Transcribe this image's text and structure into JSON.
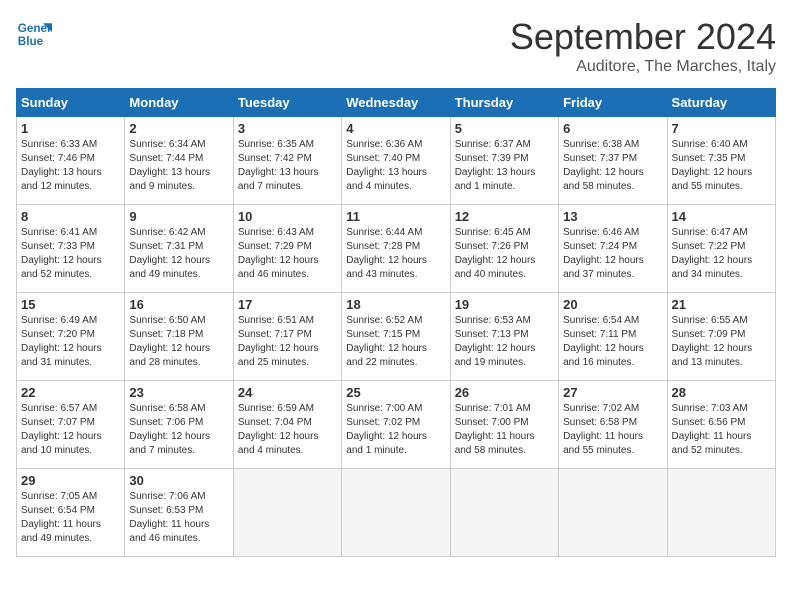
{
  "header": {
    "logo_line1": "General",
    "logo_line2": "Blue",
    "month": "September 2024",
    "location": "Auditore, The Marches, Italy"
  },
  "weekdays": [
    "Sunday",
    "Monday",
    "Tuesday",
    "Wednesday",
    "Thursday",
    "Friday",
    "Saturday"
  ],
  "weeks": [
    [
      {
        "day": "1",
        "lines": [
          "Sunrise: 6:33 AM",
          "Sunset: 7:46 PM",
          "Daylight: 13 hours",
          "and 12 minutes."
        ]
      },
      {
        "day": "2",
        "lines": [
          "Sunrise: 6:34 AM",
          "Sunset: 7:44 PM",
          "Daylight: 13 hours",
          "and 9 minutes."
        ]
      },
      {
        "day": "3",
        "lines": [
          "Sunrise: 6:35 AM",
          "Sunset: 7:42 PM",
          "Daylight: 13 hours",
          "and 7 minutes."
        ]
      },
      {
        "day": "4",
        "lines": [
          "Sunrise: 6:36 AM",
          "Sunset: 7:40 PM",
          "Daylight: 13 hours",
          "and 4 minutes."
        ]
      },
      {
        "day": "5",
        "lines": [
          "Sunrise: 6:37 AM",
          "Sunset: 7:39 PM",
          "Daylight: 13 hours",
          "and 1 minute."
        ]
      },
      {
        "day": "6",
        "lines": [
          "Sunrise: 6:38 AM",
          "Sunset: 7:37 PM",
          "Daylight: 12 hours",
          "and 58 minutes."
        ]
      },
      {
        "day": "7",
        "lines": [
          "Sunrise: 6:40 AM",
          "Sunset: 7:35 PM",
          "Daylight: 12 hours",
          "and 55 minutes."
        ]
      }
    ],
    [
      {
        "day": "8",
        "lines": [
          "Sunrise: 6:41 AM",
          "Sunset: 7:33 PM",
          "Daylight: 12 hours",
          "and 52 minutes."
        ]
      },
      {
        "day": "9",
        "lines": [
          "Sunrise: 6:42 AM",
          "Sunset: 7:31 PM",
          "Daylight: 12 hours",
          "and 49 minutes."
        ]
      },
      {
        "day": "10",
        "lines": [
          "Sunrise: 6:43 AM",
          "Sunset: 7:29 PM",
          "Daylight: 12 hours",
          "and 46 minutes."
        ]
      },
      {
        "day": "11",
        "lines": [
          "Sunrise: 6:44 AM",
          "Sunset: 7:28 PM",
          "Daylight: 12 hours",
          "and 43 minutes."
        ]
      },
      {
        "day": "12",
        "lines": [
          "Sunrise: 6:45 AM",
          "Sunset: 7:26 PM",
          "Daylight: 12 hours",
          "and 40 minutes."
        ]
      },
      {
        "day": "13",
        "lines": [
          "Sunrise: 6:46 AM",
          "Sunset: 7:24 PM",
          "Daylight: 12 hours",
          "and 37 minutes."
        ]
      },
      {
        "day": "14",
        "lines": [
          "Sunrise: 6:47 AM",
          "Sunset: 7:22 PM",
          "Daylight: 12 hours",
          "and 34 minutes."
        ]
      }
    ],
    [
      {
        "day": "15",
        "lines": [
          "Sunrise: 6:49 AM",
          "Sunset: 7:20 PM",
          "Daylight: 12 hours",
          "and 31 minutes."
        ]
      },
      {
        "day": "16",
        "lines": [
          "Sunrise: 6:50 AM",
          "Sunset: 7:18 PM",
          "Daylight: 12 hours",
          "and 28 minutes."
        ]
      },
      {
        "day": "17",
        "lines": [
          "Sunrise: 6:51 AM",
          "Sunset: 7:17 PM",
          "Daylight: 12 hours",
          "and 25 minutes."
        ]
      },
      {
        "day": "18",
        "lines": [
          "Sunrise: 6:52 AM",
          "Sunset: 7:15 PM",
          "Daylight: 12 hours",
          "and 22 minutes."
        ]
      },
      {
        "day": "19",
        "lines": [
          "Sunrise: 6:53 AM",
          "Sunset: 7:13 PM",
          "Daylight: 12 hours",
          "and 19 minutes."
        ]
      },
      {
        "day": "20",
        "lines": [
          "Sunrise: 6:54 AM",
          "Sunset: 7:11 PM",
          "Daylight: 12 hours",
          "and 16 minutes."
        ]
      },
      {
        "day": "21",
        "lines": [
          "Sunrise: 6:55 AM",
          "Sunset: 7:09 PM",
          "Daylight: 12 hours",
          "and 13 minutes."
        ]
      }
    ],
    [
      {
        "day": "22",
        "lines": [
          "Sunrise: 6:57 AM",
          "Sunset: 7:07 PM",
          "Daylight: 12 hours",
          "and 10 minutes."
        ]
      },
      {
        "day": "23",
        "lines": [
          "Sunrise: 6:58 AM",
          "Sunset: 7:06 PM",
          "Daylight: 12 hours",
          "and 7 minutes."
        ]
      },
      {
        "day": "24",
        "lines": [
          "Sunrise: 6:59 AM",
          "Sunset: 7:04 PM",
          "Daylight: 12 hours",
          "and 4 minutes."
        ]
      },
      {
        "day": "25",
        "lines": [
          "Sunrise: 7:00 AM",
          "Sunset: 7:02 PM",
          "Daylight: 12 hours",
          "and 1 minute."
        ]
      },
      {
        "day": "26",
        "lines": [
          "Sunrise: 7:01 AM",
          "Sunset: 7:00 PM",
          "Daylight: 11 hours",
          "and 58 minutes."
        ]
      },
      {
        "day": "27",
        "lines": [
          "Sunrise: 7:02 AM",
          "Sunset: 6:58 PM",
          "Daylight: 11 hours",
          "and 55 minutes."
        ]
      },
      {
        "day": "28",
        "lines": [
          "Sunrise: 7:03 AM",
          "Sunset: 6:56 PM",
          "Daylight: 11 hours",
          "and 52 minutes."
        ]
      }
    ],
    [
      {
        "day": "29",
        "lines": [
          "Sunrise: 7:05 AM",
          "Sunset: 6:54 PM",
          "Daylight: 11 hours",
          "and 49 minutes."
        ]
      },
      {
        "day": "30",
        "lines": [
          "Sunrise: 7:06 AM",
          "Sunset: 6:53 PM",
          "Daylight: 11 hours",
          "and 46 minutes."
        ]
      },
      {
        "day": "",
        "lines": []
      },
      {
        "day": "",
        "lines": []
      },
      {
        "day": "",
        "lines": []
      },
      {
        "day": "",
        "lines": []
      },
      {
        "day": "",
        "lines": []
      }
    ]
  ]
}
